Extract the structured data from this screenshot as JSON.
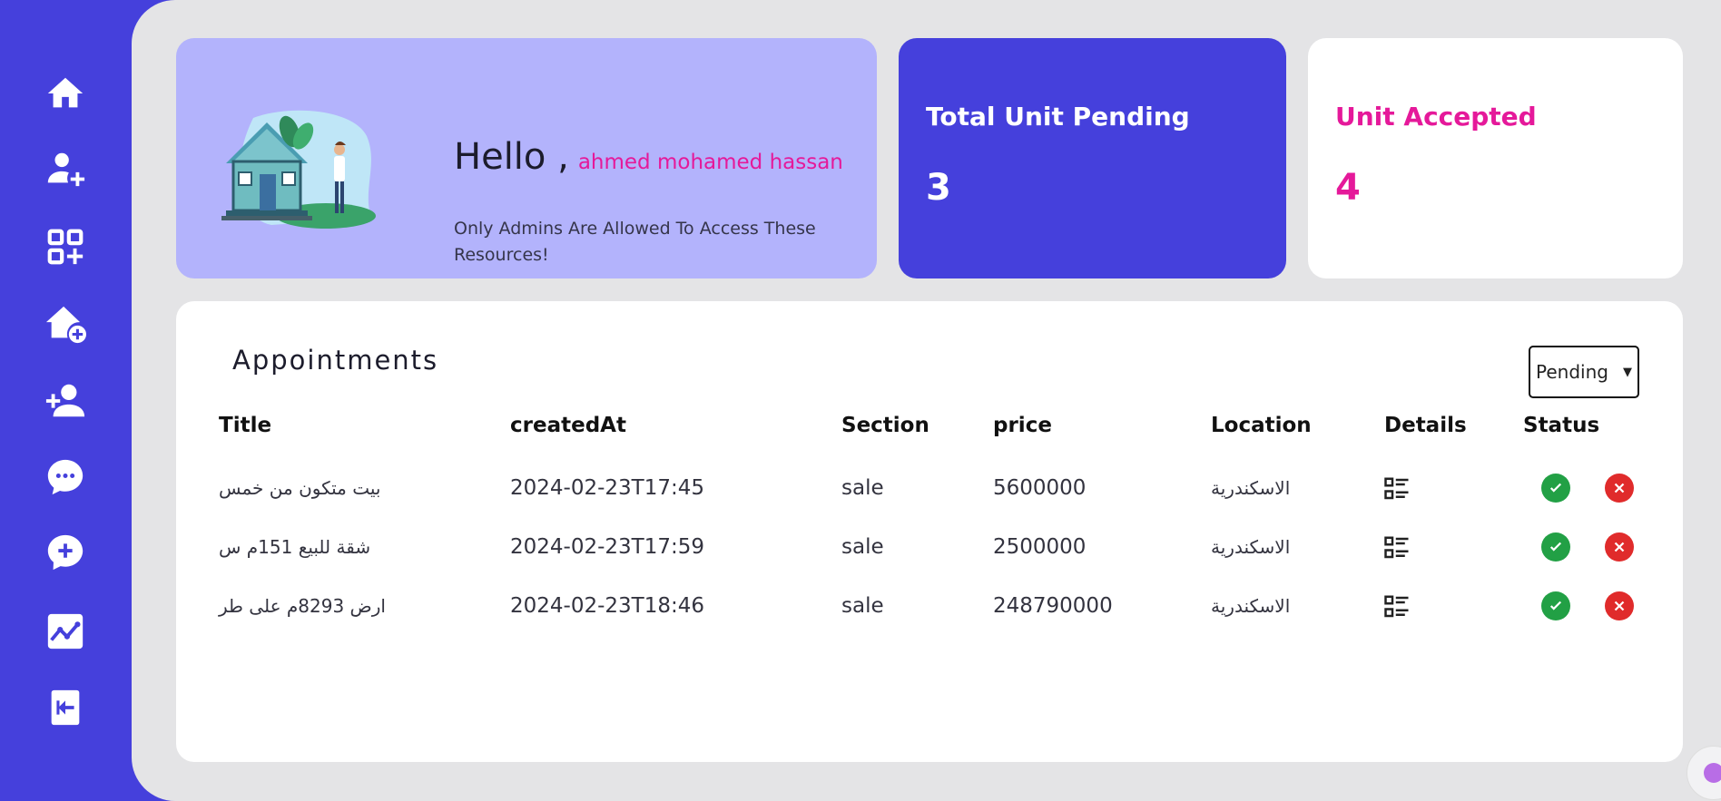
{
  "sidebar": {
    "items": [
      {
        "icon": "home-icon"
      },
      {
        "icon": "add-user-icon"
      },
      {
        "icon": "add-apps-icon"
      },
      {
        "icon": "add-home-icon"
      },
      {
        "icon": "person-add-icon"
      },
      {
        "icon": "chat-icon"
      },
      {
        "icon": "add-comment-icon"
      },
      {
        "icon": "analytics-icon"
      },
      {
        "icon": "logout-icon"
      }
    ]
  },
  "welcome": {
    "greeting": "Hello ,",
    "user_name": "ahmed mohamed hassan",
    "subtitle": "Only Admins Are Allowed To Access These Resources!"
  },
  "stats": {
    "pending": {
      "label": "Total Unit Pending",
      "value": "3"
    },
    "accepted": {
      "label": "Unit Accepted",
      "value": "4"
    }
  },
  "appointments": {
    "title": "Appointments",
    "filter": {
      "selected": "Pending"
    },
    "columns": [
      "Title",
      "createdAt",
      "Section",
      "price",
      "Location",
      "Details",
      "Status"
    ],
    "rows": [
      {
        "title": "بيت متكون من خمس",
        "createdAt": "2024-02-23T17:45",
        "section": "sale",
        "price": "5600000",
        "location": "الاسكندرية"
      },
      {
        "title": "شقة للبيع 151م س",
        "createdAt": "2024-02-23T17:59",
        "section": "sale",
        "price": "2500000",
        "location": "الاسكندرية"
      },
      {
        "title": "ارض 8293م على طر",
        "createdAt": "2024-02-23T18:46",
        "section": "sale",
        "price": "248790000",
        "location": "الاسكندرية"
      }
    ]
  },
  "colors": {
    "primary": "#4540dc",
    "accent_pink": "#e5199a",
    "welcome_bg": "#b3b3fc",
    "accept_green": "#22a045",
    "reject_red": "#e02b2b"
  }
}
